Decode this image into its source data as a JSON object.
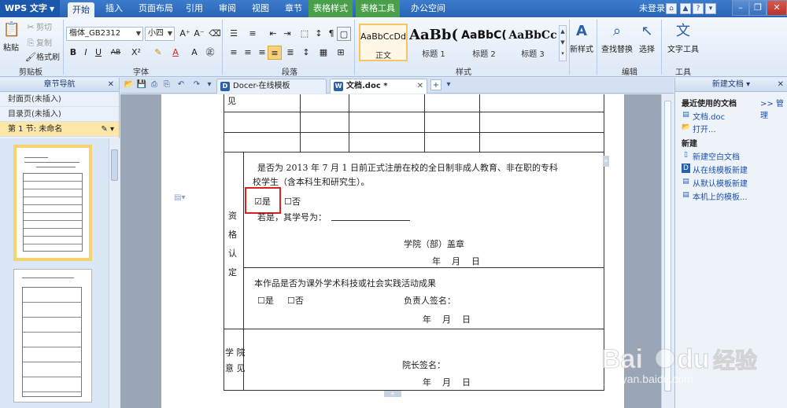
{
  "app": {
    "name": "WPS 文字",
    "login": "未登录"
  },
  "menu": {
    "tabs": [
      {
        "label": "开始"
      },
      {
        "label": "插入"
      },
      {
        "label": "页面布局"
      },
      {
        "label": "引用"
      },
      {
        "label": "审阅"
      },
      {
        "label": "视图"
      },
      {
        "label": "章节"
      },
      {
        "label": "表格样式"
      },
      {
        "label": "表格工具"
      },
      {
        "label": "办公空间"
      }
    ]
  },
  "ribbon": {
    "clipboard": {
      "paste": "粘贴",
      "cut": "剪切",
      "copy": "复制",
      "format_painter": "格式刷",
      "label": "剪贴板"
    },
    "font": {
      "name": "楷体_GB2312",
      "size": "小四",
      "label": "字体"
    },
    "paragraph": {
      "label": "段落"
    },
    "styles": {
      "label": "样式",
      "items": [
        {
          "sample": "AaBbCcDd",
          "name": "正文"
        },
        {
          "sample": "AaBb(",
          "name": "标题 1"
        },
        {
          "sample": "AaBbC(",
          "name": "标题 2"
        },
        {
          "sample": "AaBbCc",
          "name": "标题 3"
        }
      ]
    },
    "new_style": "新样式",
    "find_replace": "查找替换",
    "select": "选择",
    "edit_label": "编辑",
    "text_tools": "文字工具",
    "tools_label": "工具"
  },
  "nav": {
    "title": "章节导航",
    "items": [
      {
        "label": "封面页(未插入)"
      },
      {
        "label": "目录页(未插入)"
      },
      {
        "label": "第 1 节: 未命名"
      }
    ]
  },
  "doctabs": [
    {
      "label": "Docer-在线模板"
    },
    {
      "label": "文档.doc *"
    }
  ],
  "document": {
    "qual_label": [
      "资",
      "格",
      "认",
      "定"
    ],
    "para1_line1": "是否为 2013 年 7 月 1 日前正式注册在校的全日制非成人教育、非在职的专科",
    "para1_line2": "校学生（含本科生和研究生）。",
    "yes_checked": "☑是",
    "no_unchecked": "☐否",
    "student_no": "若是，其学号为：",
    "college_seal": "学院（部）盖章",
    "date1": "年    月    日",
    "para2": "本作品是否为课外学术科技或社会实践活动成果",
    "yes2": "☐是",
    "no2": "☐否",
    "responsible_sign": "负责人签名：",
    "date2": "年    月    日",
    "college_opinion": [
      "学 院",
      "意 见"
    ],
    "dean_sign": "院长签名：",
    "date3": "年    月    日",
    "top_cell_char": "见"
  },
  "taskpane": {
    "title": "新建文档",
    "recent_title": "最近使用的文档",
    "manage": ">> 管理",
    "recent": [
      {
        "label": "文档.doc"
      },
      {
        "label": "打开..."
      }
    ],
    "new_title": "新建",
    "new_items": [
      {
        "label": "新建空白文档"
      },
      {
        "label": "从在线模板新建"
      },
      {
        "label": "从默认模板新建"
      },
      {
        "label": "本机上的模板..."
      }
    ]
  },
  "watermark": {
    "brand": "Bai du 经验",
    "url": "jingyan.baidu.com"
  },
  "colors": {
    "accent": "#2a64b5",
    "highlight_box": "#e02020",
    "active_nav": "#fde7a6"
  }
}
